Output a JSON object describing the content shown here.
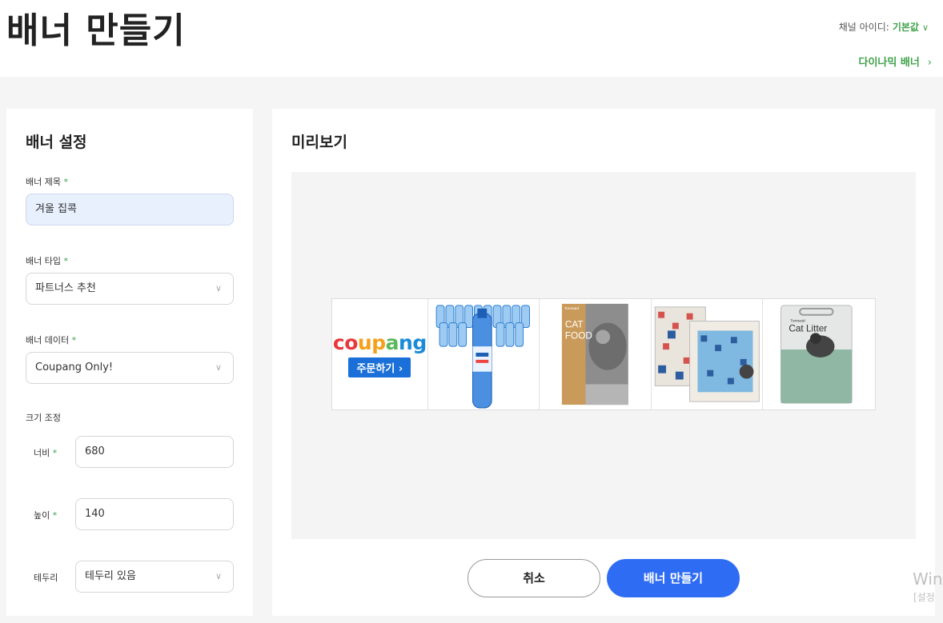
{
  "header": {
    "title": "배너 만들기",
    "channel_label": "채널 아이디:",
    "channel_value": "기본값",
    "dynamic_banner_link": "다이나믹 배너"
  },
  "settings": {
    "title": "배너 설정",
    "banner_title_label": "배너 제목",
    "banner_title_value": "겨울 집콕",
    "banner_type_label": "배너 타입",
    "banner_type_value": "파트너스 추천",
    "banner_data_label": "배너 데이터",
    "banner_data_value": "Coupang Only!",
    "size_label": "크기 조정",
    "width_label": "너비",
    "width_value": "680",
    "height_label": "높이",
    "height_value": "140",
    "border_label": "테두리",
    "border_value": "테두리 있음",
    "required_mark": "*"
  },
  "preview": {
    "title": "미리보기",
    "logo_text": "coupang",
    "order_button": "주문하기 ›",
    "products": [
      "sparkling-water-bottles",
      "cat-food-bag",
      "puzzle-boxes",
      "cat-litter-bag"
    ],
    "product_text": {
      "catfood_brand": "Tomsaid",
      "catfood_line1": "CAT",
      "catfood_line2": "FOOD",
      "litter_brand": "Tomsaid",
      "litter_name": "Cat Litter"
    },
    "logo_colors": [
      "#e8383d",
      "#f5a01a",
      "#5cb85c",
      "#1a8bd8"
    ]
  },
  "actions": {
    "cancel": "취소",
    "create": "배너 만들기"
  },
  "watermark": {
    "line1": "Win",
    "line2": "[설정"
  },
  "icons": {
    "chevron_down": "chevron-down-icon",
    "chevron_right": "chevron-right-icon"
  }
}
